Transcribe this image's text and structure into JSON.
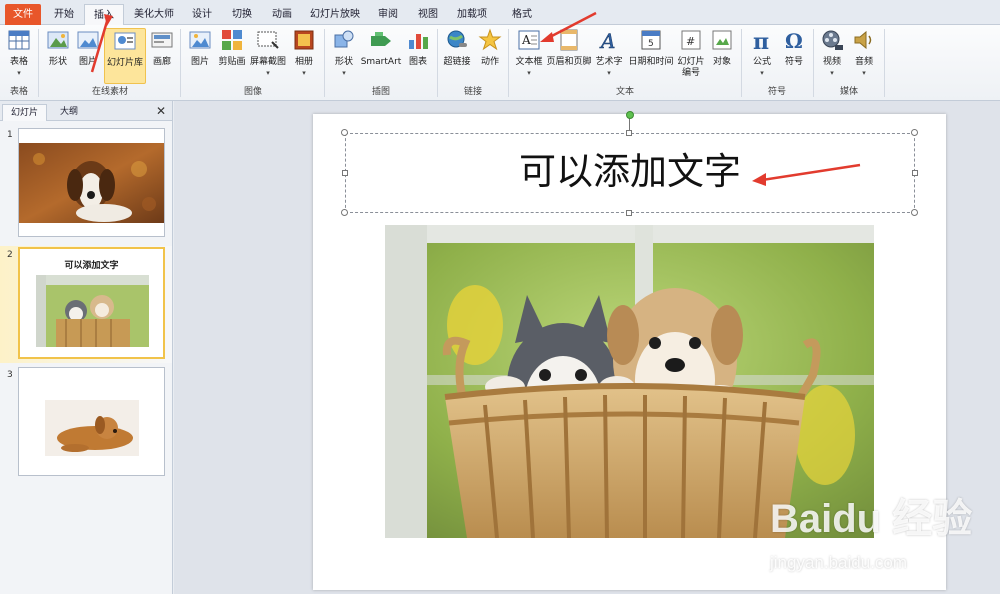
{
  "tabs": [
    "文件",
    "开始",
    "插入",
    "美化大师",
    "设计",
    "切换",
    "动画",
    "幻灯片放映",
    "审阅",
    "视图",
    "加载项",
    "格式"
  ],
  "active_tab": "插入",
  "ribbon": {
    "table": {
      "label": "表格",
      "group": "表格"
    },
    "online": {
      "shape_label": "形状",
      "picture_label": "图片",
      "slidelib_label": "幻灯片库",
      "canvas_label": "画廊",
      "group": "在线素材"
    },
    "image": {
      "picture_label": "图片",
      "clipart_label": "剪贴画",
      "screenshot_label": "屏幕截图",
      "album_label": "相册",
      "group": "图像"
    },
    "illustration": {
      "shape_label": "形状",
      "smartart_label": "SmartArt",
      "chart_label": "图表",
      "group": "插图"
    },
    "link": {
      "hyperlink_label": "超链接",
      "action_label": "动作",
      "group": "链接"
    },
    "text": {
      "textbox_label": "文本框",
      "headerfooter_label": "页眉和页脚",
      "wordart_label": "艺术字",
      "datetime_label": "日期和时间",
      "slidenum_label": "幻灯片\n编号",
      "object_label": "对象",
      "group": "文本"
    },
    "symbols": {
      "equation_label": "公式",
      "symbol_label": "符号",
      "group": "符号"
    },
    "media": {
      "video_label": "视频",
      "audio_label": "音频",
      "group": "媒体"
    },
    "dropdown_glyph": "▾"
  },
  "panel": {
    "tab_slides": "幻灯片",
    "tab_outline": "大纲",
    "close_glyph": "✕",
    "slides": [
      {
        "number": "1"
      },
      {
        "number": "2",
        "title": "可以添加文字"
      },
      {
        "number": "3"
      }
    ]
  },
  "slide": {
    "title": "可以添加文字"
  },
  "watermark": {
    "logo": "Baidu 经验",
    "url": "jingyan.baidu.com"
  },
  "colors": {
    "file_tab": "#e8562a",
    "annotation_arrow": "#e23b2e",
    "selection": "#f1c34a"
  }
}
